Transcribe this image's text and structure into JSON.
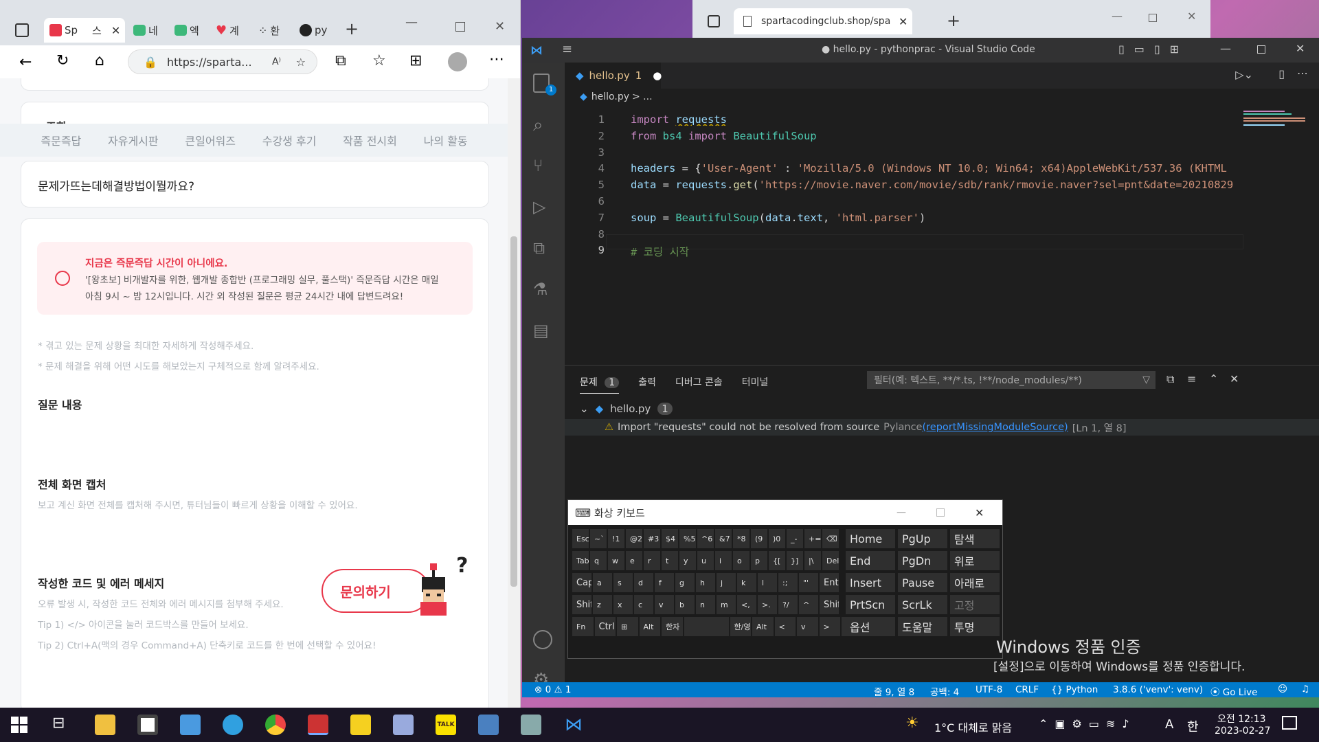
{
  "edge_left": {
    "tabs": [
      {
        "label": "Sp",
        "icon": "sparta-icon"
      },
      {
        "label": "스",
        "icon": "sparta-icon"
      },
      {
        "label": "네",
        "icon": "chat-icon"
      },
      {
        "label": "엑",
        "icon": "chat-icon"
      },
      {
        "label": "계",
        "icon": "heart-icon"
      },
      {
        "label": "환",
        "icon": "dots-icon"
      },
      {
        "label": "py",
        "icon": "github-icon"
      }
    ],
    "address": "https://sparta...",
    "subnav": [
      "즉문즉답",
      "자유게시판",
      "큰일어워즈",
      "수강생 후기",
      "작품 전시회",
      "나의 활동"
    ],
    "question_title": "문제가뜨는데해결방법이뭘까요?",
    "notice_title": "지금은 즉문즉답 시간이 아니에요.",
    "notice_line1": "'[왕초보] 비개발자를 위한, 웹개발 종합반 (프로그래밍 실무, 풀스택)' 즉문즉답 시간은 매일",
    "notice_line2": "아침 9시 ~ 밤 12시입니다. 시간 외 작성된 질문은 평균 24시간 내에 답변드려요!",
    "hint1": "* 겪고 있는 문제 상황을 최대한 자세하게 작성해주세요.",
    "hint2": "* 문제 해결을 위해 어떤 시도를 해보았는지 구체적으로 함께 알려주세요.",
    "section_question": "질문 내용",
    "section_capture": "전체 화면 캡처",
    "capture_hint": "보고 계신 화면 전체를 캡처해 주시면, 튜터님들이 빠르게 상황을 이해할 수 있어요.",
    "section_code": "작성한 코드 및 에러 메세지",
    "code_hint": "오류 발생 시, 작성한 코드 전체와 에러 메시지를 첨부해 주세요.",
    "tip1": "Tip 1) </> 아이콘을 눌러 코드박스를 만들어 보세요.",
    "tip2": "Tip 2) Ctrl+A(맥의 경우 Command+A) 단축키로 코드를 한 번에 선택할 수 있어요!",
    "inquiry_button": "문의하기",
    "partial_header": "조회"
  },
  "edge_right": {
    "tab_title": "spartacodingclub.shop/sparta_ap"
  },
  "vscode": {
    "title": "● hello.py - pythonprac - Visual Studio Code",
    "tab_label": "hello.py",
    "tab_badge": "1",
    "breadcrumb_file": "hello.py",
    "breadcrumb_rest": "> ...",
    "lines": [
      {
        "n": "1",
        "parts": [
          [
            "kw",
            "import "
          ],
          [
            "var",
            "requests"
          ]
        ]
      },
      {
        "n": "2",
        "parts": [
          [
            "kw",
            "from "
          ],
          [
            "cls",
            "bs4 "
          ],
          [
            "kw",
            "import "
          ],
          [
            "cls",
            "BeautifulSoup"
          ]
        ]
      },
      {
        "n": "3",
        "parts": []
      },
      {
        "n": "4",
        "parts": [
          [
            "var",
            "headers"
          ],
          [
            "",
            " = {"
          ],
          [
            "str",
            "'User-Agent'"
          ],
          [
            "",
            " : "
          ],
          [
            "str",
            "'Mozilla/5.0 (Windows NT 10.0; Win64; x64)AppleWebKit/537.36 (KHTML"
          ]
        ]
      },
      {
        "n": "5",
        "parts": [
          [
            "var",
            "data"
          ],
          [
            "",
            " = "
          ],
          [
            "var",
            "requests"
          ],
          [
            "",
            "."
          ],
          [
            "fn",
            "get"
          ],
          [
            "",
            "("
          ],
          [
            "str",
            "'https://movie.naver.com/movie/sdb/rank/rmovie.naver?sel=pnt&date=20210829"
          ]
        ]
      },
      {
        "n": "6",
        "parts": []
      },
      {
        "n": "7",
        "parts": [
          [
            "var",
            "soup"
          ],
          [
            "",
            " = "
          ],
          [
            "cls",
            "BeautifulSoup"
          ],
          [
            "",
            "("
          ],
          [
            "var",
            "data"
          ],
          [
            "",
            "."
          ],
          [
            "var",
            "text"
          ],
          [
            "",
            ", "
          ],
          [
            "str",
            "'html.parser'"
          ],
          [
            "",
            ")"
          ]
        ]
      },
      {
        "n": "8",
        "parts": []
      },
      {
        "n": "9",
        "parts": [
          [
            "cm",
            "# 코딩 시작"
          ]
        ]
      }
    ],
    "panel_tabs": [
      "문제",
      "출력",
      "디버그 콘솔",
      "터미널"
    ],
    "problems_count": "1",
    "filter_placeholder": "필터(예: 텍스트, **/*.ts, !**/node_modules/**)",
    "problem_file": "hello.py",
    "problem_file_count": "1",
    "problem_message": "Import \"requests\" could not be resolved from source",
    "problem_source": "Pylance",
    "problem_code": "(reportMissingModuleSource)",
    "problem_location": "[Ln 1, 열 8]",
    "status": {
      "errors": "0",
      "warnings": "1",
      "position": "줄 9, 열 8",
      "spaces": "공백: 4",
      "encoding": "UTF-8",
      "eol": "CRLF",
      "language": "Python",
      "interpreter": "3.8.6 ('venv': venv)",
      "golive": "Go Live"
    }
  },
  "keyboard": {
    "title": "화상 키보드",
    "rows": [
      [
        "Esc",
        "~`",
        "!1",
        "@2",
        "#3",
        "$4",
        "%5",
        "^6",
        "&7",
        "*8",
        "(9",
        ")0",
        "_-",
        "+=",
        "⌫"
      ],
      [
        "Tab",
        "q",
        "w",
        "e",
        "r",
        "t",
        "y",
        "u",
        "i",
        "o",
        "p",
        "{[",
        "}]",
        "|\\",
        "Del"
      ],
      [
        "Caps",
        "a",
        "s",
        "d",
        "f",
        "g",
        "h",
        "j",
        "k",
        "l",
        ":;",
        "\"'",
        "Enter"
      ],
      [
        "Shift",
        "z",
        "x",
        "c",
        "v",
        "b",
        "n",
        "m",
        "<,",
        ">.",
        "?/",
        "^",
        "Shift"
      ],
      [
        "Fn",
        "Ctrl",
        "⊞",
        "Alt",
        "한자",
        "",
        "한/영",
        "Alt",
        "<",
        "v",
        ">",
        "▤"
      ]
    ],
    "nav_keys": [
      [
        "Home",
        "PgUp",
        "탐색"
      ],
      [
        "End",
        "PgDn",
        "위로"
      ],
      [
        "Insert",
        "Pause",
        "아래로"
      ],
      [
        "PrtScn",
        "ScrLk",
        "고정"
      ],
      [
        "옵션",
        "도움말",
        "투명"
      ]
    ]
  },
  "watermark": {
    "line1": "Windows 정품 인증",
    "line2": "[설정]으로 이동하여 Windows를 정품 인증합니다."
  },
  "taskbar": {
    "weather": "1°C  대체로 맑음",
    "time": "오전 12:13",
    "date": "2023-02-27",
    "ime": "한",
    "lang": "A"
  },
  "colors": {
    "vscode_status": "#007acc",
    "sparta_red": "#e8374a",
    "warning": "#cca700"
  }
}
